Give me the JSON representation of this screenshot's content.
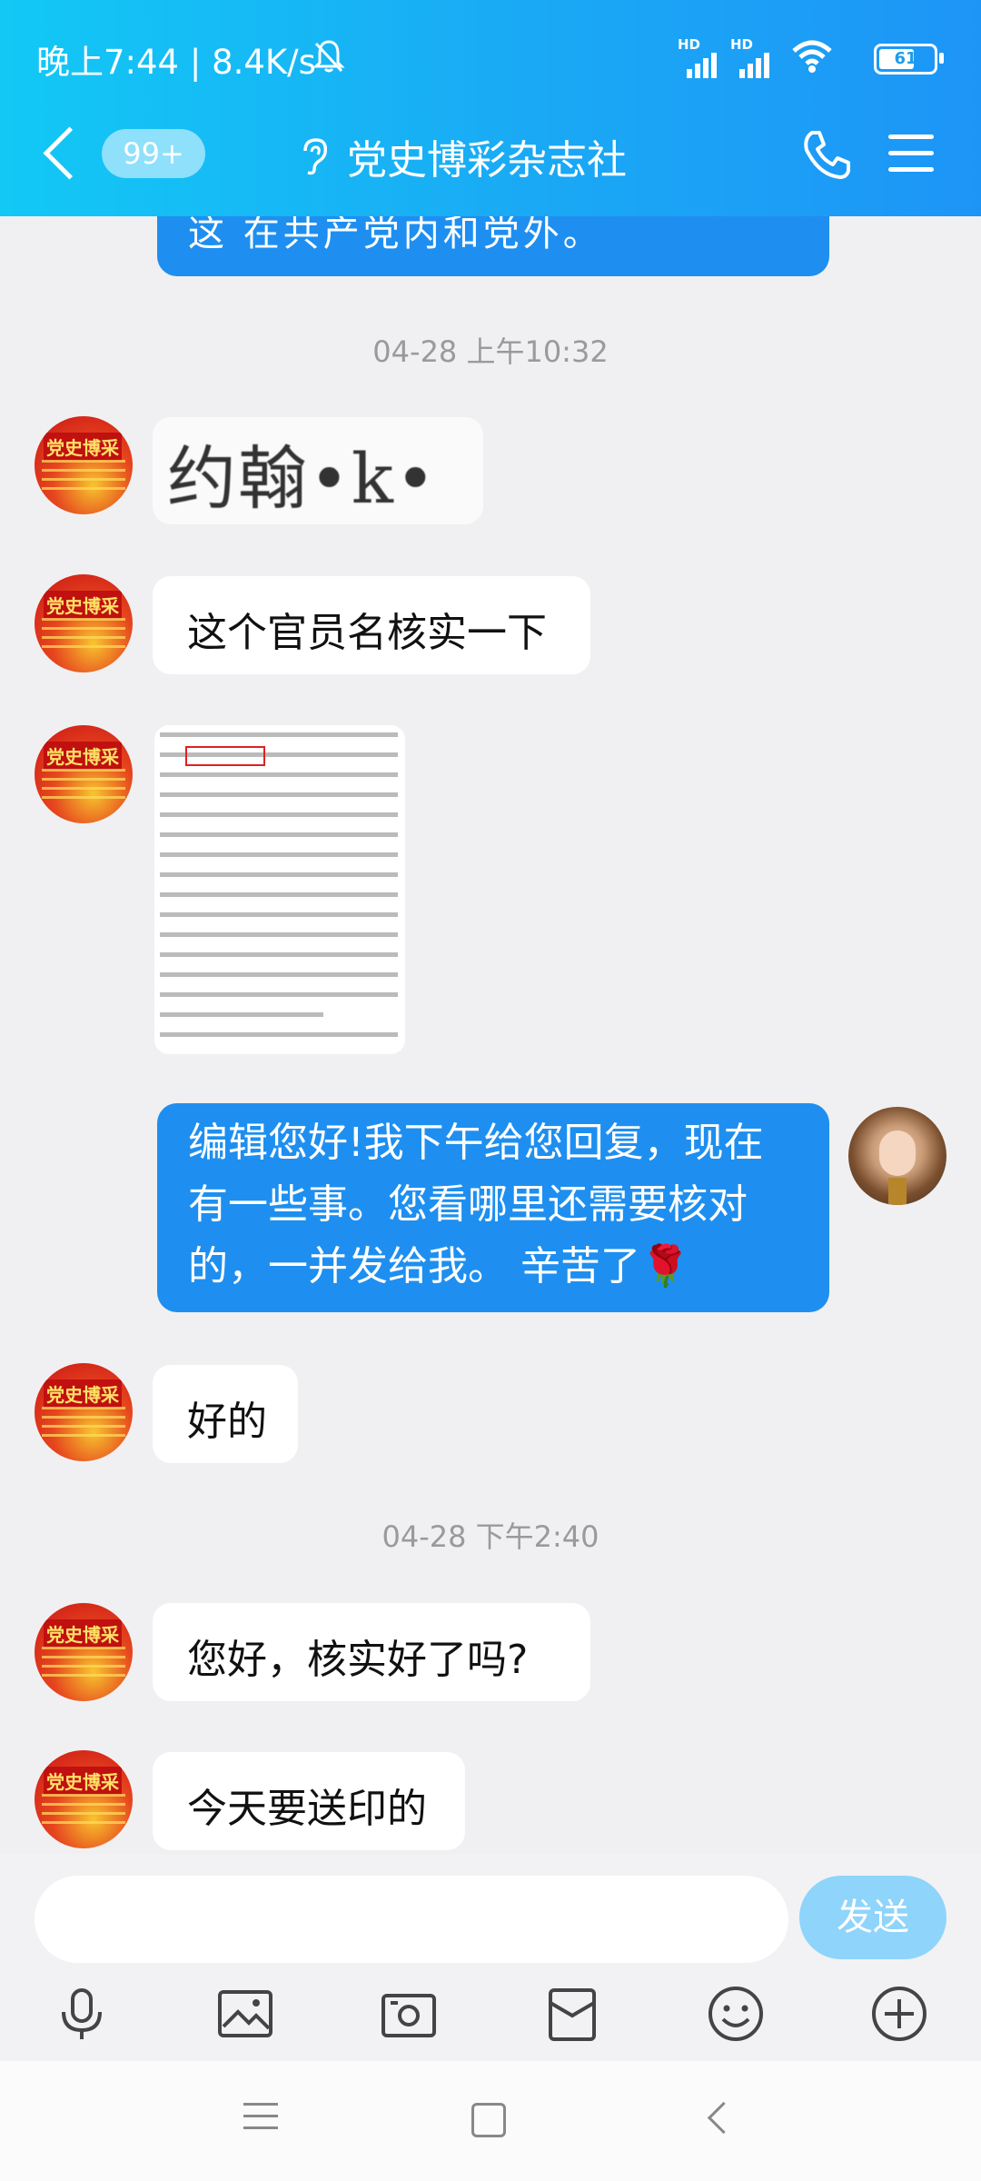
{
  "status": {
    "time_speed": "晚上7:44 | 8.4K/s",
    "battery": "61",
    "hd1": "HD",
    "hd2": "HD"
  },
  "header": {
    "badge": "99+",
    "title": "党史博彩杂志社"
  },
  "messages": {
    "top_text": "这     在共产党内和党外。",
    "time1": "04-28 上午10:32",
    "image_text": "约翰•k•",
    "msg1": "这个官员名核实一下",
    "me_lines": [
      "编辑您好!我下午给您回复，现在",
      "有一些事。您看哪里还需要核对",
      "的，一并发给我。 辛苦了🌹"
    ],
    "msg2": "好的",
    "time2": "04-28 下午2:40",
    "msg3": "您好，核实好了吗?",
    "msg4": "今天要送印的"
  },
  "avatar_logo": "党史博采",
  "input": {
    "send": "发送",
    "placeholder": ""
  },
  "tools": [
    "microphone-icon",
    "image-icon",
    "camera-icon",
    "red-packet-icon",
    "emoji-icon",
    "plus-icon"
  ]
}
